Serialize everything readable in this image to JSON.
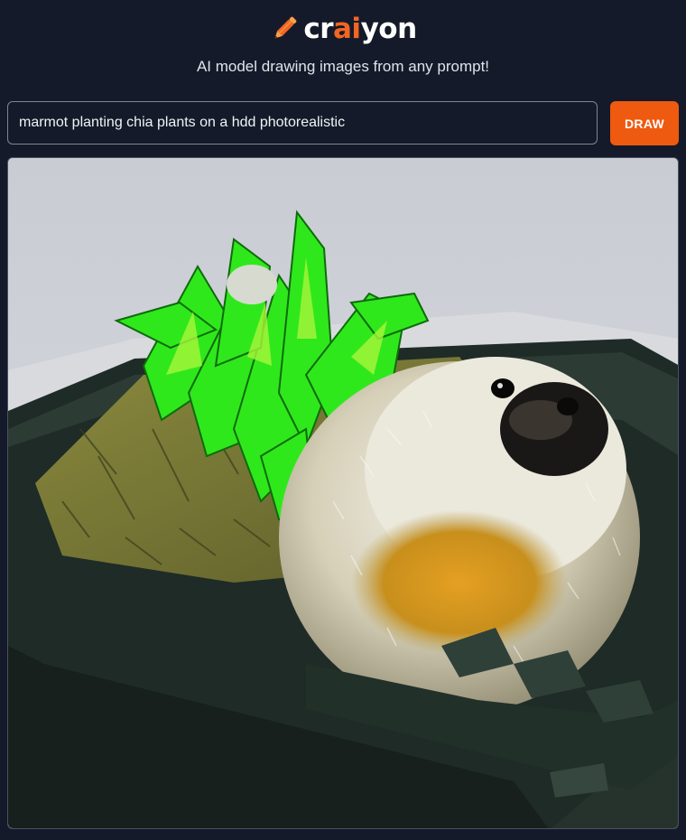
{
  "header": {
    "logo_text_before": "cr",
    "logo_text_accent": "ai",
    "logo_text_after": "yon",
    "logo_icon": "pencil-icon",
    "tagline": "AI model drawing images from any prompt!"
  },
  "prompt": {
    "value": "marmot planting chia plants on a hdd photorealistic",
    "button_label": "DRAW"
  },
  "result": {
    "image_subject": "marmot with green plants in a hard drive tray"
  },
  "colors": {
    "background": "#141a29",
    "accent": "#ee5a0f",
    "text": "#ffffff"
  }
}
